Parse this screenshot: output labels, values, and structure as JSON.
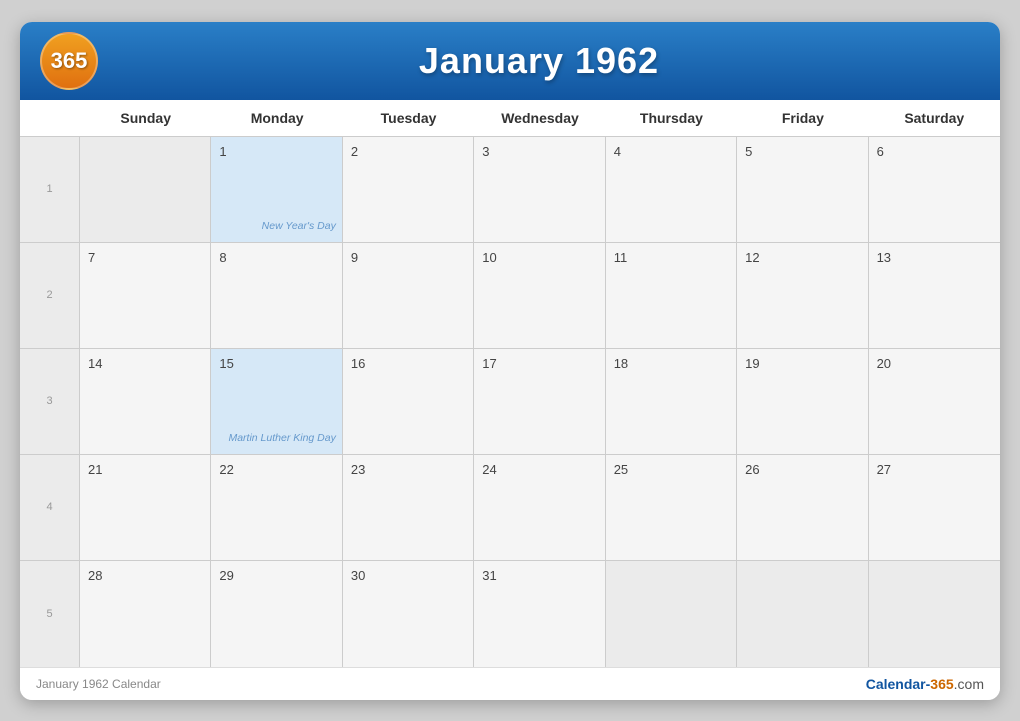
{
  "header": {
    "logo": "365",
    "title": "January 1962"
  },
  "footer": {
    "left": "January 1962 Calendar",
    "right_calendar": "Calendar-",
    "right_365": "365",
    "right_dotcom": ".com"
  },
  "day_headers": [
    "Sunday",
    "Monday",
    "Tuesday",
    "Wednesday",
    "Thursday",
    "Friday",
    "Saturday"
  ],
  "weeks": [
    {
      "week_num": "1",
      "days": [
        {
          "date": "",
          "empty": true
        },
        {
          "date": "1",
          "holiday": true,
          "holiday_name": "New Year's Day"
        },
        {
          "date": "2"
        },
        {
          "date": "3"
        },
        {
          "date": "4"
        },
        {
          "date": "5"
        },
        {
          "date": "6"
        }
      ]
    },
    {
      "week_num": "2",
      "days": [
        {
          "date": "7"
        },
        {
          "date": "8"
        },
        {
          "date": "9"
        },
        {
          "date": "10"
        },
        {
          "date": "11"
        },
        {
          "date": "12"
        },
        {
          "date": "13"
        }
      ]
    },
    {
      "week_num": "3",
      "days": [
        {
          "date": "14"
        },
        {
          "date": "15",
          "holiday": true,
          "holiday_name": "Martin Luther King Day"
        },
        {
          "date": "16"
        },
        {
          "date": "17"
        },
        {
          "date": "18"
        },
        {
          "date": "19"
        },
        {
          "date": "20"
        }
      ]
    },
    {
      "week_num": "4",
      "days": [
        {
          "date": "21"
        },
        {
          "date": "22"
        },
        {
          "date": "23"
        },
        {
          "date": "24"
        },
        {
          "date": "25"
        },
        {
          "date": "26"
        },
        {
          "date": "27"
        }
      ]
    },
    {
      "week_num": "5",
      "days": [
        {
          "date": "28"
        },
        {
          "date": "29"
        },
        {
          "date": "30"
        },
        {
          "date": "31"
        },
        {
          "date": ""
        },
        {
          "date": ""
        },
        {
          "date": ""
        }
      ]
    }
  ]
}
